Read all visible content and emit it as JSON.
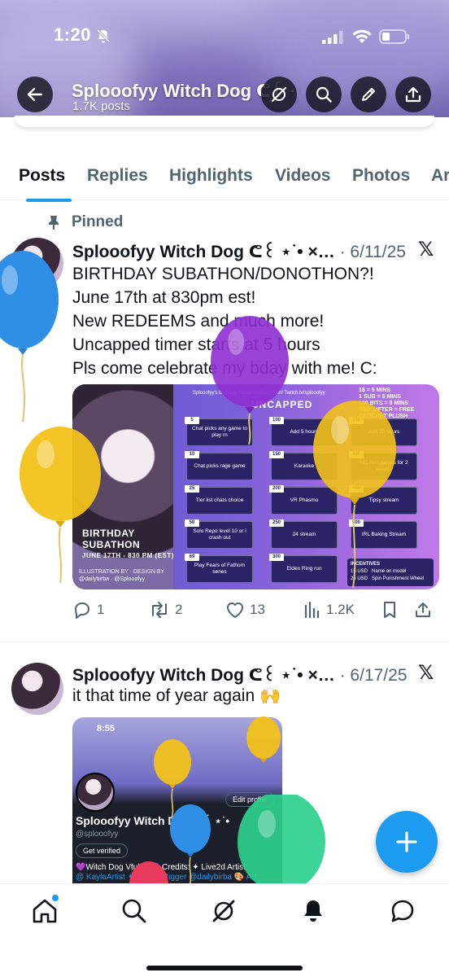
{
  "status_bar": {
    "time": "1:20"
  },
  "header": {
    "profile_name": "Splooofyy Witch Dog ᕦ꒰ · •ᕥ ⋆…",
    "post_count": "1.7K posts"
  },
  "tabs": [
    {
      "label": "Posts",
      "active": true
    },
    {
      "label": "Replies",
      "active": false
    },
    {
      "label": "Highlights",
      "active": false
    },
    {
      "label": "Videos",
      "active": false
    },
    {
      "label": "Photos",
      "active": false
    },
    {
      "label": "Ar",
      "active": false
    }
  ],
  "post1": {
    "pinned_label": "Pinned",
    "author": "Splooofyy Witch Dog ᕦ꒰ ⋆˙• ×…",
    "date": "· 6/11/25",
    "text": "BIRTHDAY SUBATHON/DONOTHON?!\nJune 17th at 830pm est!\nNew REDEEMS and much more!\nUncapped timer starts at 5 hours\nPls come celebrate my bday with me! C:",
    "image": {
      "header_title": "Splooofyy's Birthday Subathon/Donothon! Twitch.tv/splooofyy",
      "uncapped": "UNCAPPED",
      "rates": [
        "1$ = 5 MINS",
        "1 SUB = 5 MINS",
        "100 BITS = 5 MINS",
        "TOP GIFTER = FREE CROCHET PLUSH"
      ],
      "bday_title": [
        "BIRTHDAY",
        "SUBATHON"
      ],
      "bday_date": "JUNE 17TH - 830 PM (EST)",
      "credits": [
        "ILLUSTRATION BY",
        "@dailybirba",
        "DESIGN BY",
        "@Splooofyy"
      ],
      "boxes": [
        {
          "num": "5",
          "text": "Chat picks any game to play rn"
        },
        {
          "num": "10",
          "text": "Chat picks rage game"
        },
        {
          "num": "25",
          "text": "Tier list chats choice"
        },
        {
          "num": "50",
          "text": "Solo Repo level 10 or i crash out"
        },
        {
          "num": "69",
          "text": "Play Fears of Fathom series"
        },
        {
          "num": "100",
          "text": "Add 5 hours"
        },
        {
          "num": "150",
          "text": "Karaoke"
        },
        {
          "num": "200",
          "text": "VR Phasmo"
        },
        {
          "num": "250",
          "text": "24 stream"
        },
        {
          "num": "300",
          "text": "Elden Ring run"
        },
        {
          "num": "350",
          "text": "Add 10 hours"
        },
        {
          "num": "400",
          "text": "NO Riot games for 2 weeks"
        },
        {
          "num": "450",
          "text": "Tipsy stream"
        },
        {
          "num": "500",
          "text": "IRL Baking Stream"
        }
      ],
      "incentives_title": "INCENTIVES",
      "incentives": [
        {
          "amount": "15 USD",
          "text": "Name on model"
        },
        {
          "amount": "25 USD",
          "text": "Spin Punishment Wheel"
        }
      ]
    },
    "stats": {
      "replies": "1",
      "reposts": "2",
      "likes": "13",
      "views": "1.2K"
    }
  },
  "post2": {
    "author": "Splooofyy Witch Dog ᕦ꒰ ⋆˙• ×…",
    "date": "· 6/17/25",
    "text": "it that time of year again 🙌",
    "image": {
      "time": "8:55",
      "name": "Splooofyy Witch Dog ᕦ꒰ ⋆˙•",
      "handle": "@splooofyy",
      "verified": "Get verified",
      "edit": "Edit profile",
      "bio": "💜Witch Dog Vtuber💙 Credits: ✦ Live2d Artist",
      "bio2": "@ KaylaArtist ✦ Live2d Rigger @dailybirba 🎨 Art"
    }
  },
  "colors": {
    "accent": "#1d9bf0",
    "text_primary": "#0f1419",
    "text_secondary": "#536471",
    "balloon_blue": "#2f8fe6",
    "balloon_purple": "#8e2fd1",
    "balloon_yellow": "#f2c21a",
    "balloon_green": "#2ed08e",
    "balloon_pink": "#e83a5c"
  },
  "icons": {
    "back": "arrow-left-icon",
    "grok": "grok-icon",
    "search": "search-icon",
    "edit": "pencil-icon",
    "share": "share-icon",
    "nav": [
      "home-icon",
      "search-icon",
      "grok-icon",
      "notifications-icon",
      "messages-icon"
    ]
  }
}
